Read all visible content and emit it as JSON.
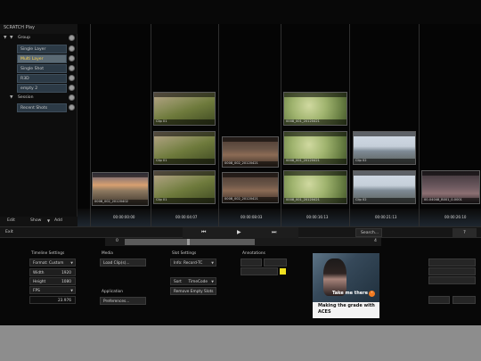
{
  "app": {
    "title": "SCRATCH Play"
  },
  "groups": {
    "rows": [
      {
        "label": "Group",
        "kind": "group"
      },
      {
        "label": "Single Layer",
        "kind": "item"
      },
      {
        "label": "Multi Layer",
        "kind": "item",
        "selected": true
      },
      {
        "label": "Single Shot",
        "kind": "item"
      },
      {
        "label": "R3D",
        "kind": "item"
      },
      {
        "label": "empty 2",
        "kind": "item"
      },
      {
        "label": "Session",
        "kind": "group"
      },
      {
        "label": "Recent Shots",
        "kind": "item"
      }
    ]
  },
  "strip_bar": {
    "edit": "Edit",
    "show": "Show",
    "add": "Add"
  },
  "timeline": {
    "timecodes": [
      "00:00:00:00",
      "00:00:04:07",
      "00:00:08:03",
      "00:00:16:13",
      "00:00:21:13",
      "00:00:26:10"
    ],
    "clips": [
      {
        "label": "Clip 01",
        "image": "grass-field"
      },
      {
        "label": "0008_002_20120421",
        "image": "woman-portrait"
      },
      {
        "label": "0008_001_20120421",
        "image": "tree"
      },
      {
        "label": "Clip 02",
        "image": "sky-landscape"
      },
      {
        "label": "0008_002_20120402",
        "image": "sunset-clouds"
      },
      {
        "label": "00-04048_B001_0-0001",
        "image": "people"
      }
    ]
  },
  "transport": {
    "exit": "Exit",
    "search": "Search...",
    "help": "?"
  },
  "scrub": {
    "start": "0",
    "end": "4"
  },
  "timeline_settings": {
    "heading": "Timeline Settings",
    "format": "Format: Custom",
    "width_label": "Width",
    "width_value": "1920",
    "height_label": "Height",
    "height_value": "1080",
    "fps_label": "FPS",
    "fps_value": "23.976"
  },
  "media": {
    "heading": "Media",
    "load_clips": "Load Clip(s)..."
  },
  "application": {
    "heading": "Application",
    "preferences": "Preferences..."
  },
  "slot_settings": {
    "heading": "Slot Settings",
    "info": "Info: Record-TC",
    "sort_label": "Sort",
    "sort_value": "TimeCode",
    "remove_empty": "Remove Empty Slots"
  },
  "annotations": {
    "heading": "Annotations",
    "color": "#f0e020"
  },
  "ad": {
    "take": "Take me there",
    "caption_line1": "Making the grade with",
    "caption_line2": "ACES"
  },
  "colors": {
    "accent": "#ffd24a",
    "ad_orange": "#f27b21",
    "item_bg": "#2c3a46"
  }
}
